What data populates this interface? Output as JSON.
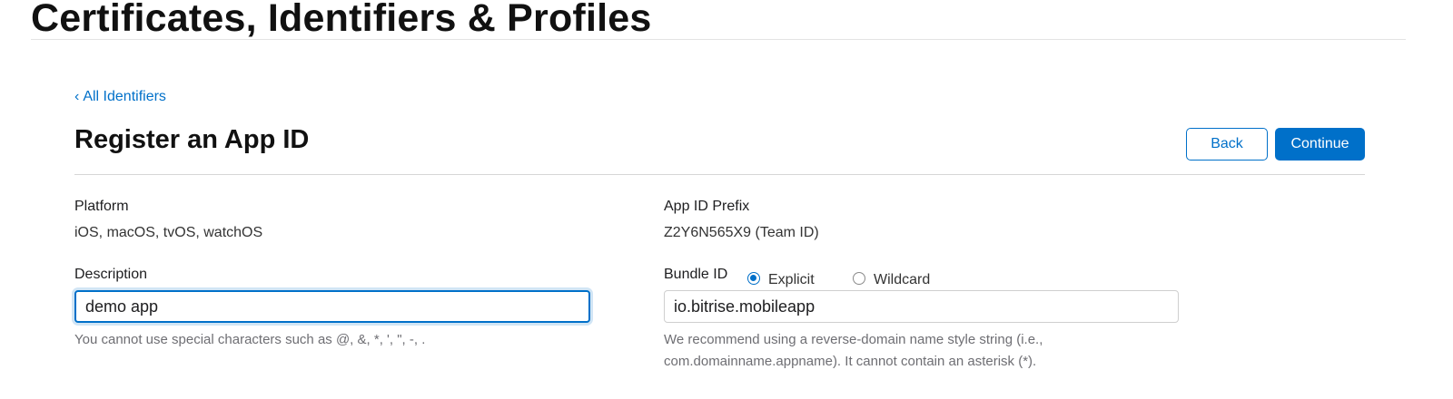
{
  "header": {
    "title": "Certificates, Identifiers & Profiles"
  },
  "nav": {
    "back_link_chevron": "‹",
    "back_link_label": "All Identifiers"
  },
  "section": {
    "title": "Register an App ID"
  },
  "actions": {
    "back_label": "Back",
    "continue_label": "Continue"
  },
  "platform": {
    "label": "Platform",
    "value": "iOS, macOS, tvOS, watchOS"
  },
  "prefix": {
    "label": "App ID Prefix",
    "value": "Z2Y6N565X9 (Team ID)"
  },
  "description": {
    "label": "Description",
    "value": "demo app",
    "hint": "You cannot use special characters such as @, &, *, ', \", -, ."
  },
  "bundle": {
    "label": "Bundle ID",
    "options": [
      {
        "label": "Explicit",
        "selected": true
      },
      {
        "label": "Wildcard",
        "selected": false
      }
    ],
    "value": "io.bitrise.mobileapp",
    "hint_line1": "We recommend using a reverse-domain name style string (i.e.,",
    "hint_line2": "com.domainname.appname). It cannot contain an asterisk (*)."
  },
  "colors": {
    "accent": "#0070c9",
    "text": "#1d1d1f",
    "hint_text": "#6e6e73",
    "divider": "#d6d6d6"
  }
}
